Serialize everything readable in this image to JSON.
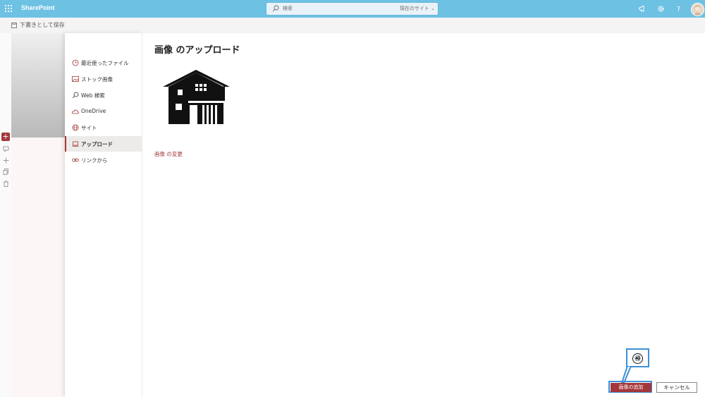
{
  "header": {
    "app_name": "SharePoint",
    "search_placeholder": "検索",
    "search_scope": "現在のサイト",
    "brand_color": "#6dc1e3"
  },
  "command_bar": {
    "save_draft_label": "下書きとして保存"
  },
  "panel_nav": {
    "items": [
      {
        "label": "最近使ったファイル",
        "icon": "clock-icon"
      },
      {
        "label": "ストック画像",
        "icon": "image-icon"
      },
      {
        "label": "Web 検索",
        "icon": "search-icon"
      },
      {
        "label": "OneDrive",
        "icon": "cloud-icon"
      },
      {
        "label": "サイト",
        "icon": "globe-icon"
      },
      {
        "label": "アップロード",
        "icon": "laptop-icon",
        "active": true
      },
      {
        "label": "リンクから",
        "icon": "link-icon"
      }
    ]
  },
  "main": {
    "title": "画像 のアップロード",
    "change_link": "画像 の変更",
    "add_button": "画像の追加",
    "cancel_button": "キャンセル"
  },
  "callout": {
    "number": "㊵",
    "color": "#3d8fd6"
  },
  "accent_color": "#a4373a"
}
